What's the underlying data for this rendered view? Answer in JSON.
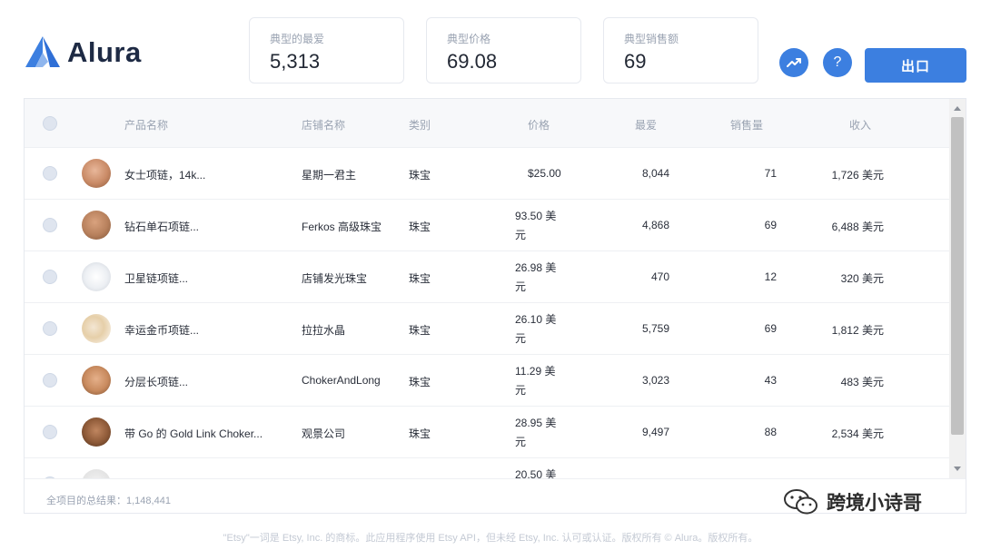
{
  "brand": {
    "name": "Alura",
    "accent": "#3c7fe0"
  },
  "stats": [
    {
      "label": "典型的最爱",
      "value": "5,313"
    },
    {
      "label": "典型价格",
      "value": "69.08"
    },
    {
      "label": "典型销售额",
      "value": "69"
    }
  ],
  "header": {
    "help_glyph": "?",
    "export_label": "出口"
  },
  "table": {
    "columns": [
      "产品名称",
      "店铺名称",
      "类别",
      "价格",
      "最爱",
      "销售量",
      "收入"
    ],
    "rows": [
      {
        "name": "女士项链，14k...",
        "shop": "星期一君主",
        "category": "珠宝",
        "price": "$25.00",
        "favorites": "8,044",
        "sales": "71",
        "revenue": "1,726 美元"
      },
      {
        "name": "钻石单石项链...",
        "shop": "Ferkos 高级珠宝",
        "category": "珠宝",
        "price": "93.50 美元",
        "favorites": "4,868",
        "sales": "69",
        "revenue": "6,488 美元"
      },
      {
        "name": "卫星链项链...",
        "shop": "店铺发光珠宝",
        "category": "珠宝",
        "price": "26.98 美元",
        "favorites": "470",
        "sales": "12",
        "revenue": "320 美元"
      },
      {
        "name": "幸运金币项链...",
        "shop": "拉拉水晶",
        "category": "珠宝",
        "price": "26.10 美元",
        "favorites": "5,759",
        "sales": "69",
        "revenue": "1,812 美元"
      },
      {
        "name": "分层长项链...",
        "shop": "ChokerAndLong",
        "category": "珠宝",
        "price": "11.29 美元",
        "favorites": "3,023",
        "sales": "43",
        "revenue": "483 美元"
      },
      {
        "name": "带 Go 的 Gold Link Choker...",
        "shop": "观景公司",
        "category": "珠宝",
        "price": "28.95 美元",
        "favorites": "9,497",
        "sales": "88",
        "revenue": "2,534 美元"
      },
      {
        "name": "",
        "shop": "",
        "category": "",
        "price": "20.50 美",
        "favorites": "",
        "sales": "",
        "revenue": ""
      }
    ]
  },
  "footer": {
    "total": "全项目的总结果：1,148,441"
  },
  "watermark": {
    "text": "跨境小诗哥"
  },
  "bottom_note": "\"Etsy\"一词是 Etsy, Inc. 的商标。此应用程序使用 Etsy API，但未经 Etsy, Inc. 认可或认证。版权所有 © Alura。版权所有。"
}
